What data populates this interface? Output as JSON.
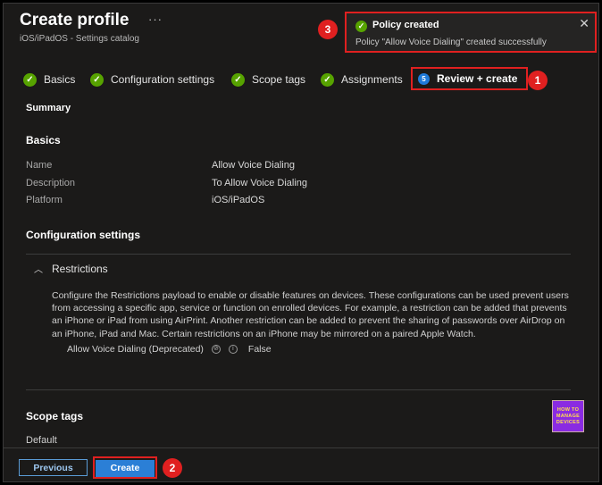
{
  "header": {
    "title": "Create profile",
    "more_icon": "···",
    "subtitle": "iOS/iPadOS - Settings catalog"
  },
  "toast": {
    "title": "Policy created",
    "message": "Policy \"Allow Voice Dialing\" created successfully",
    "close_icon": "✕",
    "status_color": "#57a300"
  },
  "steps": [
    {
      "label": "Basics",
      "state": "done"
    },
    {
      "label": "Configuration settings",
      "state": "done"
    },
    {
      "label": "Scope tags",
      "state": "done"
    },
    {
      "label": "Assignments",
      "state": "done"
    },
    {
      "label": "Review + create",
      "state": "active",
      "number": "5"
    }
  ],
  "summary": {
    "heading": "Summary",
    "basics": {
      "heading": "Basics",
      "rows": [
        {
          "label": "Name",
          "value": "Allow Voice Dialing"
        },
        {
          "label": "Description",
          "value": "To Allow Voice Dialing"
        },
        {
          "label": "Platform",
          "value": "iOS/iPadOS"
        }
      ]
    },
    "configuration": {
      "heading": "Configuration settings",
      "group": "Restrictions",
      "description": "Configure the Restrictions payload to enable or disable features on devices. These configurations can be used prevent users from accessing a specific app, service or function on enrolled devices. For example, a restriction can be added that prevents an iPhone or iPad from using AirPrint. Another restriction can be added to prevent the sharing of passwords over AirDrop on an iPhone, iPad and Mac. Certain restrictions on an iPhone may be mirrored on a paired Apple Watch.",
      "setting_name": "Allow Voice Dialing (Deprecated)",
      "setting_value": "False"
    },
    "scope_tags": {
      "heading": "Scope tags",
      "value": "Default"
    }
  },
  "annotations": [
    "1",
    "2",
    "3"
  ],
  "logo": {
    "lines": [
      "HOW TO",
      "MANAGE",
      "DEVICES"
    ]
  },
  "footer": {
    "previous_label": "Previous",
    "create_label": "Create"
  },
  "colors": {
    "accent": "#2b7fd6",
    "success": "#57a300",
    "highlight": "#e02020"
  }
}
